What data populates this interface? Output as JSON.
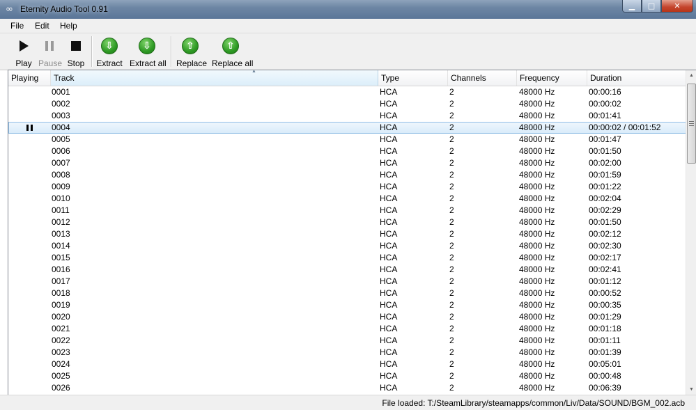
{
  "window": {
    "title": "Eternity Audio Tool 0.91",
    "app_icon": "infinity-icon",
    "controls": [
      "minimize-icon",
      "maximize-icon",
      "close-icon"
    ]
  },
  "menu": [
    "File",
    "Edit",
    "Help"
  ],
  "toolbar": {
    "play": "Play",
    "pause": "Pause",
    "stop": "Stop",
    "extract": "Extract",
    "extract_all": "Extract all",
    "replace": "Replace",
    "replace_all": "Replace all"
  },
  "columns": [
    "Playing",
    "Track",
    "Type",
    "Channels",
    "Frequency",
    "Duration"
  ],
  "sorted_column": "Track",
  "rows": [
    {
      "playing": "",
      "track": "0001",
      "type": "HCA",
      "channels": "2",
      "frequency": "48000 Hz",
      "duration": "00:00:16"
    },
    {
      "playing": "",
      "track": "0002",
      "type": "HCA",
      "channels": "2",
      "frequency": "48000 Hz",
      "duration": "00:00:02"
    },
    {
      "playing": "",
      "track": "0003",
      "type": "HCA",
      "channels": "2",
      "frequency": "48000 Hz",
      "duration": "00:01:41"
    },
    {
      "playing": "pause-icon",
      "track": "0004",
      "type": "HCA",
      "channels": "2",
      "frequency": "48000 Hz",
      "duration": "00:00:02 / 00:01:52",
      "selected": true
    },
    {
      "playing": "",
      "track": "0005",
      "type": "HCA",
      "channels": "2",
      "frequency": "48000 Hz",
      "duration": "00:01:47"
    },
    {
      "playing": "",
      "track": "0006",
      "type": "HCA",
      "channels": "2",
      "frequency": "48000 Hz",
      "duration": "00:01:50"
    },
    {
      "playing": "",
      "track": "0007",
      "type": "HCA",
      "channels": "2",
      "frequency": "48000 Hz",
      "duration": "00:02:00"
    },
    {
      "playing": "",
      "track": "0008",
      "type": "HCA",
      "channels": "2",
      "frequency": "48000 Hz",
      "duration": "00:01:59"
    },
    {
      "playing": "",
      "track": "0009",
      "type": "HCA",
      "channels": "2",
      "frequency": "48000 Hz",
      "duration": "00:01:22"
    },
    {
      "playing": "",
      "track": "0010",
      "type": "HCA",
      "channels": "2",
      "frequency": "48000 Hz",
      "duration": "00:02:04"
    },
    {
      "playing": "",
      "track": "0011",
      "type": "HCA",
      "channels": "2",
      "frequency": "48000 Hz",
      "duration": "00:02:29"
    },
    {
      "playing": "",
      "track": "0012",
      "type": "HCA",
      "channels": "2",
      "frequency": "48000 Hz",
      "duration": "00:01:50"
    },
    {
      "playing": "",
      "track": "0013",
      "type": "HCA",
      "channels": "2",
      "frequency": "48000 Hz",
      "duration": "00:02:12"
    },
    {
      "playing": "",
      "track": "0014",
      "type": "HCA",
      "channels": "2",
      "frequency": "48000 Hz",
      "duration": "00:02:30"
    },
    {
      "playing": "",
      "track": "0015",
      "type": "HCA",
      "channels": "2",
      "frequency": "48000 Hz",
      "duration": "00:02:17"
    },
    {
      "playing": "",
      "track": "0016",
      "type": "HCA",
      "channels": "2",
      "frequency": "48000 Hz",
      "duration": "00:02:41"
    },
    {
      "playing": "",
      "track": "0017",
      "type": "HCA",
      "channels": "2",
      "frequency": "48000 Hz",
      "duration": "00:01:12"
    },
    {
      "playing": "",
      "track": "0018",
      "type": "HCA",
      "channels": "2",
      "frequency": "48000 Hz",
      "duration": "00:00:52"
    },
    {
      "playing": "",
      "track": "0019",
      "type": "HCA",
      "channels": "2",
      "frequency": "48000 Hz",
      "duration": "00:00:35"
    },
    {
      "playing": "",
      "track": "0020",
      "type": "HCA",
      "channels": "2",
      "frequency": "48000 Hz",
      "duration": "00:01:29"
    },
    {
      "playing": "",
      "track": "0021",
      "type": "HCA",
      "channels": "2",
      "frequency": "48000 Hz",
      "duration": "00:01:18"
    },
    {
      "playing": "",
      "track": "0022",
      "type": "HCA",
      "channels": "2",
      "frequency": "48000 Hz",
      "duration": "00:01:11"
    },
    {
      "playing": "",
      "track": "0023",
      "type": "HCA",
      "channels": "2",
      "frequency": "48000 Hz",
      "duration": "00:01:39"
    },
    {
      "playing": "",
      "track": "0024",
      "type": "HCA",
      "channels": "2",
      "frequency": "48000 Hz",
      "duration": "00:05:01"
    },
    {
      "playing": "",
      "track": "0025",
      "type": "HCA",
      "channels": "2",
      "frequency": "48000 Hz",
      "duration": "00:00:48"
    },
    {
      "playing": "",
      "track": "0026",
      "type": "HCA",
      "channels": "2",
      "frequency": "48000 Hz",
      "duration": "00:06:39"
    }
  ],
  "status": "File loaded: T:/SteamLibrary/steamapps/common/Liv/Data/SOUND/BGM_002.acb",
  "colors": {
    "selection": "#d8ebfa",
    "title_bar": "#6d86a4",
    "green_button": "#2e9a24"
  }
}
